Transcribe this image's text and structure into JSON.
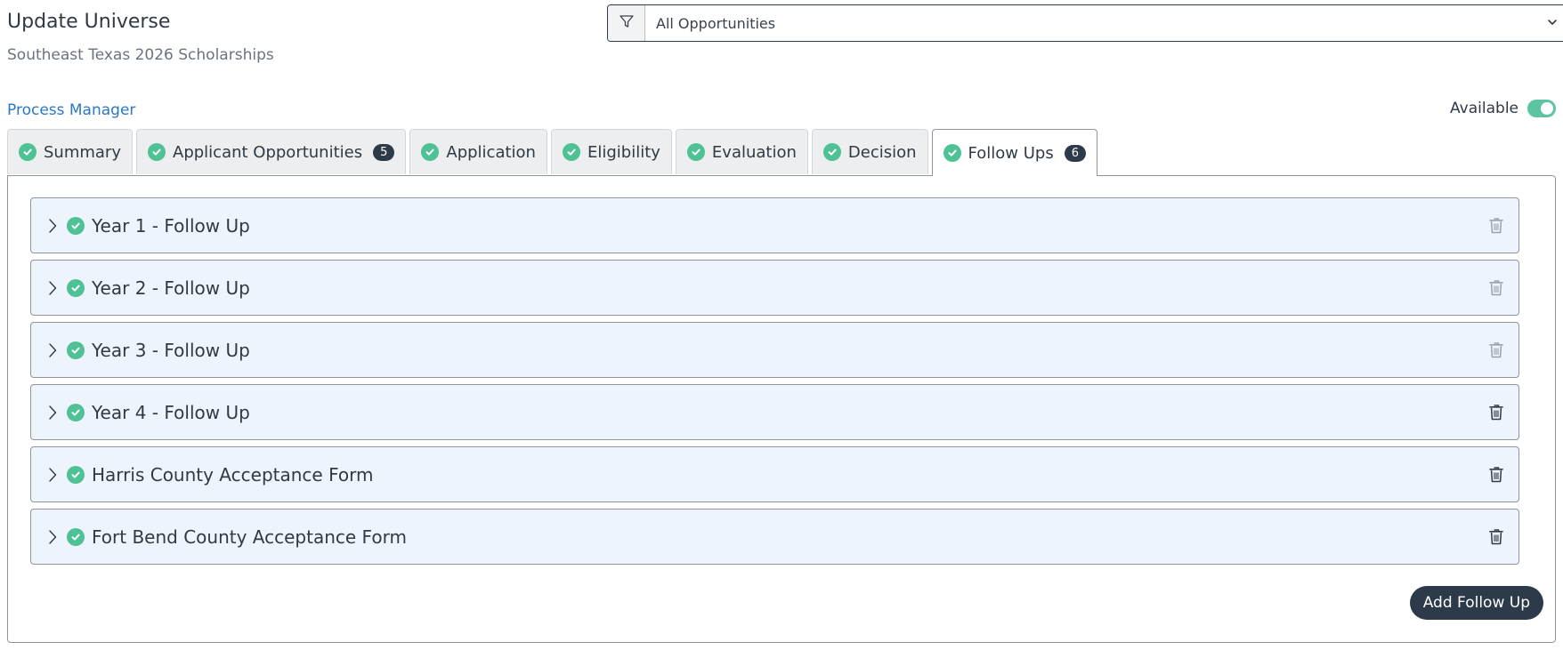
{
  "header": {
    "title": "Update Universe",
    "subtitle": "Southeast Texas 2026 Scholarships"
  },
  "filter": {
    "selected": "All Opportunities"
  },
  "process_manager": {
    "label": "Process Manager"
  },
  "availability": {
    "label": "Available",
    "enabled": true
  },
  "tabs": [
    {
      "label": "Summary",
      "complete": true
    },
    {
      "label": "Applicant Opportunities",
      "complete": true,
      "badge": "5"
    },
    {
      "label": "Application",
      "complete": true
    },
    {
      "label": "Eligibility",
      "complete": true
    },
    {
      "label": "Evaluation",
      "complete": true
    },
    {
      "label": "Decision",
      "complete": true
    },
    {
      "label": "Follow Ups",
      "complete": true,
      "badge": "6",
      "active": true
    }
  ],
  "followups": [
    {
      "title": "Year 1 - Follow Up",
      "complete": true,
      "delete_enabled": false
    },
    {
      "title": "Year 2 - Follow Up",
      "complete": true,
      "delete_enabled": false
    },
    {
      "title": "Year 3 - Follow Up",
      "complete": true,
      "delete_enabled": false
    },
    {
      "title": "Year 4 - Follow Up",
      "complete": true,
      "delete_enabled": true
    },
    {
      "title": "Harris County Acceptance Form",
      "complete": true,
      "delete_enabled": true
    },
    {
      "title": "Fort Bend County Acceptance Form",
      "complete": true,
      "delete_enabled": true
    }
  ],
  "actions": {
    "add_followup_label": "Add Follow Up"
  },
  "colors": {
    "success": "#4ec295",
    "primary_dark": "#2c3a4a",
    "link": "#2b78c5",
    "row_bg": "#eef4fc",
    "toggle_on": "#5cc5a0"
  },
  "icons": {
    "filter": "filter-icon",
    "dropdown": "chevron-down-icon",
    "complete": "check-circle-icon",
    "expand": "chevron-right-icon",
    "delete": "trash-icon"
  }
}
